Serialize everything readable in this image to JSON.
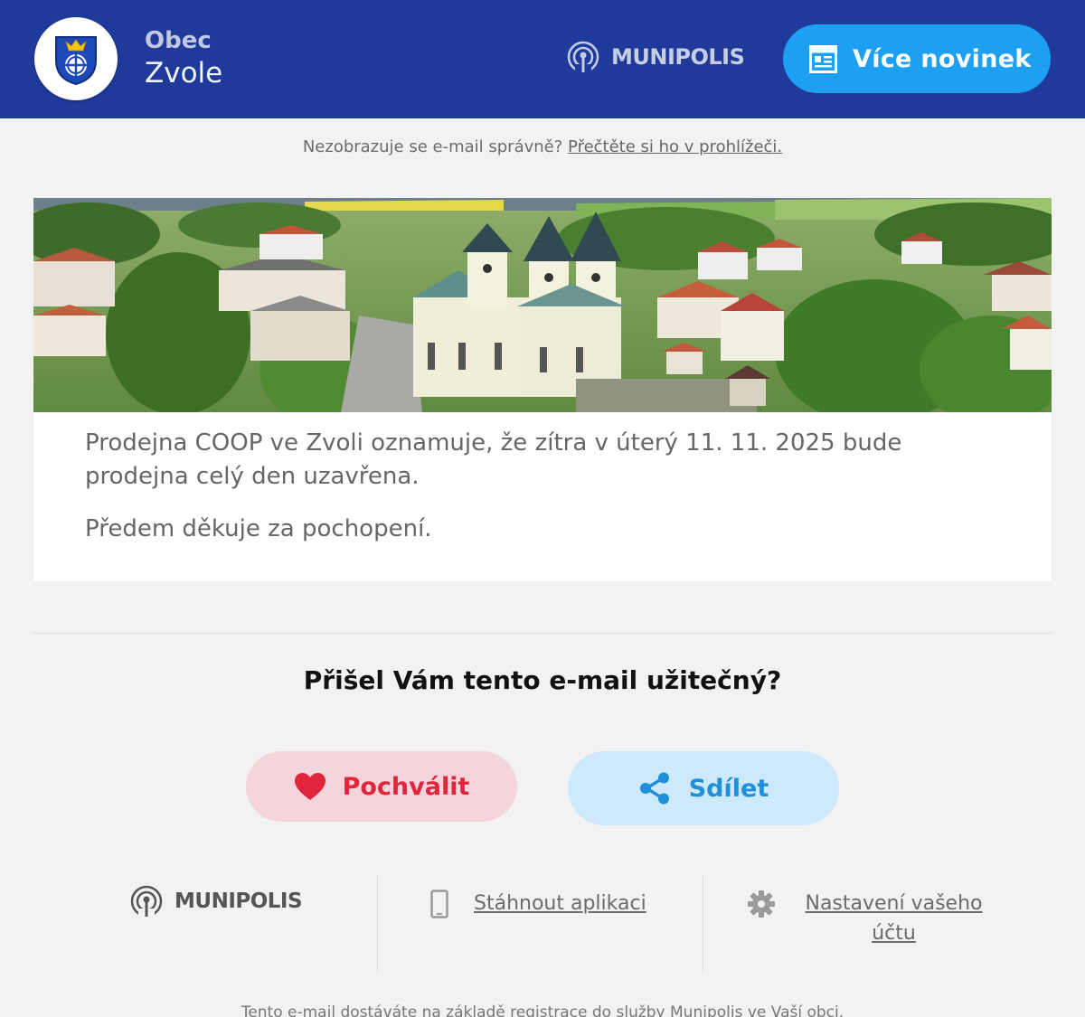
{
  "header": {
    "brand_small": "Obec",
    "brand_big": "Zvole",
    "platform_name": "MUNIPOLIS",
    "more_news_label": "Více novinek",
    "icons": {
      "crest": "municipal-crest-icon",
      "platform": "munipolis-logo-icon",
      "news": "newspaper-icon"
    },
    "colors": {
      "header_bg": "#1f3a9a",
      "button_bg": "#1ea0f2"
    }
  },
  "preheader": {
    "text": "Nezobrazuje se e-mail správně?",
    "link_label": "Přečtěte si ho v prohlížeči."
  },
  "article": {
    "body": "Prodejna COOP ve Zvoli oznamuje, že zítra v úterý 11. 11. 2025 bude prodejna celý den uzavřena.",
    "thanks": "Předem děkuje za pochopení."
  },
  "feedback": {
    "question": "Přišel Vám tento e-mail užitečný?",
    "praise_label": "Pochválit",
    "share_label": "Sdílet",
    "colors": {
      "praise_bg": "#f5d5dc",
      "praise_fg": "#e0263d",
      "share_bg": "#cde9fb",
      "share_fg": "#1e8fd8"
    }
  },
  "footer": {
    "platform_name": "MUNIPOLIS",
    "download_app_label": "Stáhnout aplikaci",
    "settings_label": "Nastavení vašeho účtu",
    "note": "Tento e-mail dostáváte na základě registrace do služby Munipolis ve Vaší obci."
  }
}
